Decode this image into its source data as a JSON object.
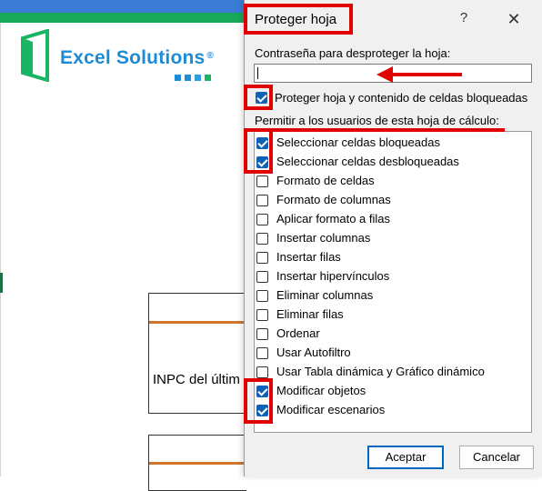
{
  "background": {
    "logo_text": "Excel Solutions",
    "logo_reg": "®",
    "logo_colors": {
      "frame": "#19b563",
      "text": "#1d8bd6",
      "dot1": "#1d8bd6",
      "dot2": "#1d8bd6",
      "dot3": "#2e9fe0",
      "dot4": "#19b563"
    },
    "cell_text": "INPC del últim"
  },
  "dialog": {
    "title": "Proteger hoja",
    "help_label": "?",
    "close_label": "✕",
    "password_label": "Contraseña para desproteger la hoja:",
    "password_value": "",
    "protect_label": "Proteger hoja y contenido de celdas bloqueadas",
    "protect_checked": true,
    "allow_label": "Permitir a los usuarios de esta hoja de cálculo:",
    "items": [
      {
        "label": "Seleccionar celdas bloqueadas",
        "checked": true
      },
      {
        "label": "Seleccionar celdas desbloqueadas",
        "checked": true
      },
      {
        "label": "Formato de celdas",
        "checked": false
      },
      {
        "label": "Formato de columnas",
        "checked": false
      },
      {
        "label": "Aplicar formato a filas",
        "checked": false
      },
      {
        "label": "Insertar columnas",
        "checked": false
      },
      {
        "label": "Insertar filas",
        "checked": false
      },
      {
        "label": "Insertar hipervínculos",
        "checked": false
      },
      {
        "label": "Eliminar columnas",
        "checked": false
      },
      {
        "label": "Eliminar filas",
        "checked": false
      },
      {
        "label": "Ordenar",
        "checked": false
      },
      {
        "label": "Usar Autofiltro",
        "checked": false
      },
      {
        "label": "Usar Tabla dinámica y Gráfico dinámico",
        "checked": false
      },
      {
        "label": "Modificar objetos",
        "checked": true
      },
      {
        "label": "Modificar escenarios",
        "checked": true
      }
    ],
    "ok_label": "Aceptar",
    "cancel_label": "Cancelar"
  },
  "accent_color": "#1061b8",
  "annotation_color": "#e00000"
}
